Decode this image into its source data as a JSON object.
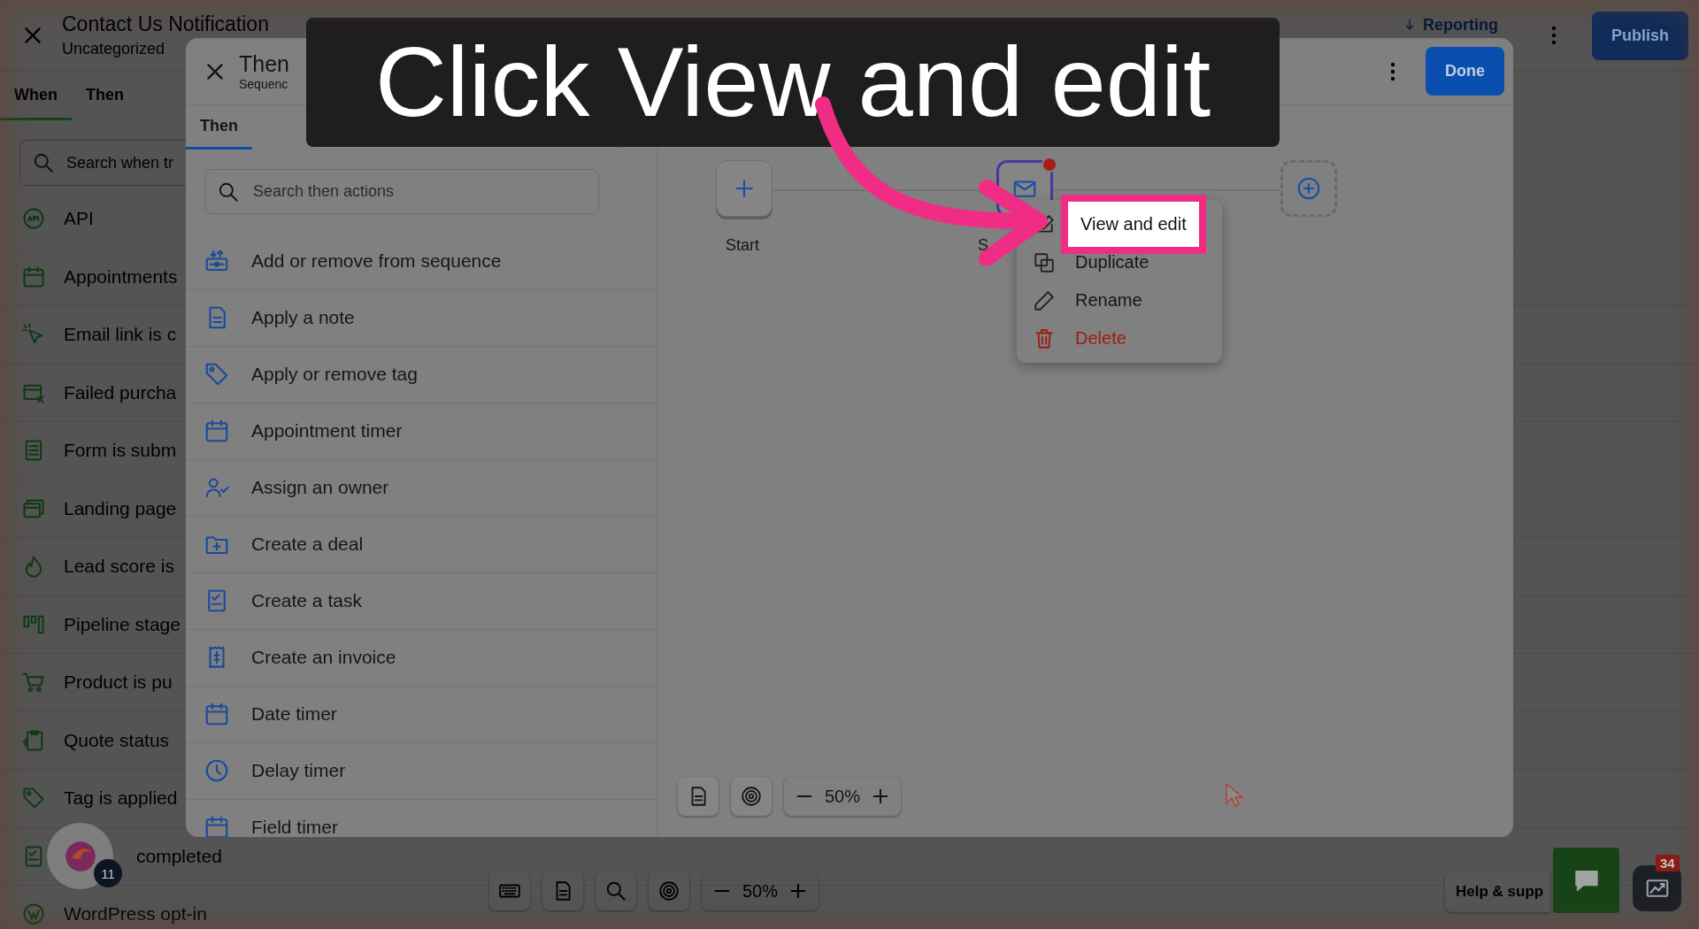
{
  "caption": "Click View and edit",
  "app": {
    "title": "Contact Us Notification",
    "subtitle": "Uncategorized",
    "reporting": "Reporting",
    "publish": "Publish",
    "tabs": [
      {
        "label": "When",
        "selected": true
      },
      {
        "label": "Then",
        "selected": false
      }
    ],
    "search": {
      "placeholder": "Search when tr"
    },
    "triggers": [
      {
        "kind": "api",
        "label": "API"
      },
      {
        "kind": "calendar",
        "label": "Appointments"
      },
      {
        "kind": "click",
        "label": "Email link is c"
      },
      {
        "kind": "card",
        "label": "Failed purcha"
      },
      {
        "kind": "form",
        "label": "Form is subm"
      },
      {
        "kind": "pages",
        "label": "Landing page"
      },
      {
        "kind": "flame",
        "label": "Lead score is"
      },
      {
        "kind": "columns",
        "label": "Pipeline stage"
      },
      {
        "kind": "cart",
        "label": "Product is pu"
      },
      {
        "kind": "quote",
        "label": "Quote status"
      },
      {
        "kind": "tag",
        "label": "Tag is applied"
      },
      {
        "kind": "task",
        "label": "completed",
        "covered": true
      },
      {
        "kind": "wp",
        "label": "WordPress opt-in"
      }
    ],
    "zoom": "50%",
    "help": "Help & supp",
    "chat_badge": "34"
  },
  "avatar": {
    "badge": "11"
  },
  "modal": {
    "title": "Then",
    "subtitle": "Sequenc",
    "done": "Done",
    "tabs": [
      {
        "label": "Then",
        "selected": true
      }
    ],
    "search": {
      "placeholder": "Search then actions"
    },
    "actions": [
      {
        "kind": "sequence",
        "label": "Add or remove from sequence"
      },
      {
        "kind": "note",
        "label": "Apply a note"
      },
      {
        "kind": "tag",
        "label": "Apply or remove tag"
      },
      {
        "kind": "calendar",
        "label": "Appointment timer"
      },
      {
        "kind": "owner",
        "label": "Assign an owner"
      },
      {
        "kind": "deal",
        "label": "Create a deal"
      },
      {
        "kind": "task",
        "label": "Create a task"
      },
      {
        "kind": "invoice",
        "label": "Create an invoice"
      },
      {
        "kind": "calendar",
        "label": "Date timer"
      },
      {
        "kind": "clock",
        "label": "Delay timer"
      },
      {
        "kind": "calendar",
        "label": "Field timer"
      }
    ],
    "nodes": [
      {
        "kind": "start",
        "label": "Start"
      },
      {
        "kind": "email",
        "label": "S",
        "alert": true
      },
      {
        "kind": "add"
      }
    ],
    "menu": [
      {
        "kind": "edit",
        "label": "View and edit",
        "selected": true
      },
      {
        "kind": "duplicate",
        "label": "Duplicate",
        "selected": false
      },
      {
        "kind": "rename",
        "label": "Rename",
        "selected": false
      },
      {
        "kind": "delete",
        "label": "Delete",
        "selected": false
      }
    ],
    "zoom": "50%"
  }
}
